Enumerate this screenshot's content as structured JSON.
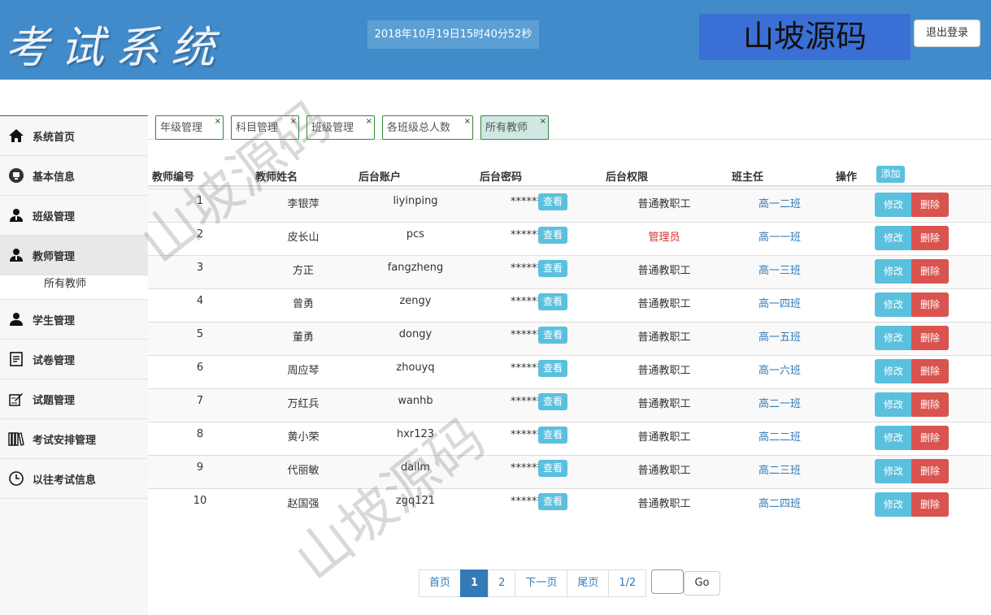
{
  "header": {
    "logo": "考试系统",
    "datetime": "2018年10月19日15时40分52秒",
    "brand": "山坡源码",
    "logout_label": "退出登录"
  },
  "sidebar": {
    "items": [
      {
        "label": "系统首页",
        "icon": "home-icon"
      },
      {
        "label": "基本信息",
        "icon": "info-icon"
      },
      {
        "label": "班级管理",
        "icon": "user-icon"
      },
      {
        "label": "教师管理",
        "icon": "user-icon"
      },
      {
        "label": "学生管理",
        "icon": "user-icon"
      },
      {
        "label": "试卷管理",
        "icon": "paper-icon"
      },
      {
        "label": "试题管理",
        "icon": "edit-icon"
      },
      {
        "label": "考试安排管理",
        "icon": "books-icon"
      },
      {
        "label": "以往考试信息",
        "icon": "clock-icon"
      }
    ],
    "sub_item": "所有教师"
  },
  "tabs": [
    {
      "label": "年级管理"
    },
    {
      "label": "科目管理"
    },
    {
      "label": "班级管理"
    },
    {
      "label": "各班级总人数"
    },
    {
      "label": "所有教师"
    }
  ],
  "tab_close": "×",
  "table": {
    "headers": {
      "id": "教师编号",
      "name": "教师姓名",
      "account": "后台账户",
      "password": "后台密码",
      "permission": "后台权限",
      "class": "班主任",
      "action": "操作"
    },
    "add_label": "添加",
    "masked_password": "******",
    "view_label": "查看",
    "edit_label": "修改",
    "delete_label": "删除",
    "rows": [
      {
        "id": "1",
        "name": "李银萍",
        "account": "liyinping",
        "permission": "普通教职工",
        "class": "高一二班"
      },
      {
        "id": "2",
        "name": "皮长山",
        "account": "pcs",
        "permission": "管理员",
        "class": "高一一班"
      },
      {
        "id": "3",
        "name": "方正",
        "account": "fangzheng",
        "permission": "普通教职工",
        "class": "高一三班"
      },
      {
        "id": "4",
        "name": "曾勇",
        "account": "zengy",
        "permission": "普通教职工",
        "class": "高一四班"
      },
      {
        "id": "5",
        "name": "董勇",
        "account": "dongy",
        "permission": "普通教职工",
        "class": "高一五班"
      },
      {
        "id": "6",
        "name": "周应琴",
        "account": "zhouyq",
        "permission": "普通教职工",
        "class": "高一六班"
      },
      {
        "id": "7",
        "name": "万红兵",
        "account": "wanhb",
        "permission": "普通教职工",
        "class": "高二一班"
      },
      {
        "id": "8",
        "name": "黄小荣",
        "account": "hxr123",
        "permission": "普通教职工",
        "class": "高二二班"
      },
      {
        "id": "9",
        "name": "代丽敏",
        "account": "dailm",
        "permission": "普通教职工",
        "class": "高二三班"
      },
      {
        "id": "10",
        "name": "赵国强",
        "account": "zgq121",
        "permission": "普通教职工",
        "class": "高二四班"
      }
    ]
  },
  "pagination": {
    "first": "首页",
    "page1": "1",
    "page2": "2",
    "next": "下一页",
    "last": "尾页",
    "info": "1/2",
    "go_label": "Go"
  },
  "watermark": "山坡源码",
  "colors": {
    "header_bg": "#428bca",
    "info_btn": "#5bc0de",
    "danger_btn": "#d9534f",
    "admin_text": "#d9302b",
    "link": "#337ab7"
  }
}
